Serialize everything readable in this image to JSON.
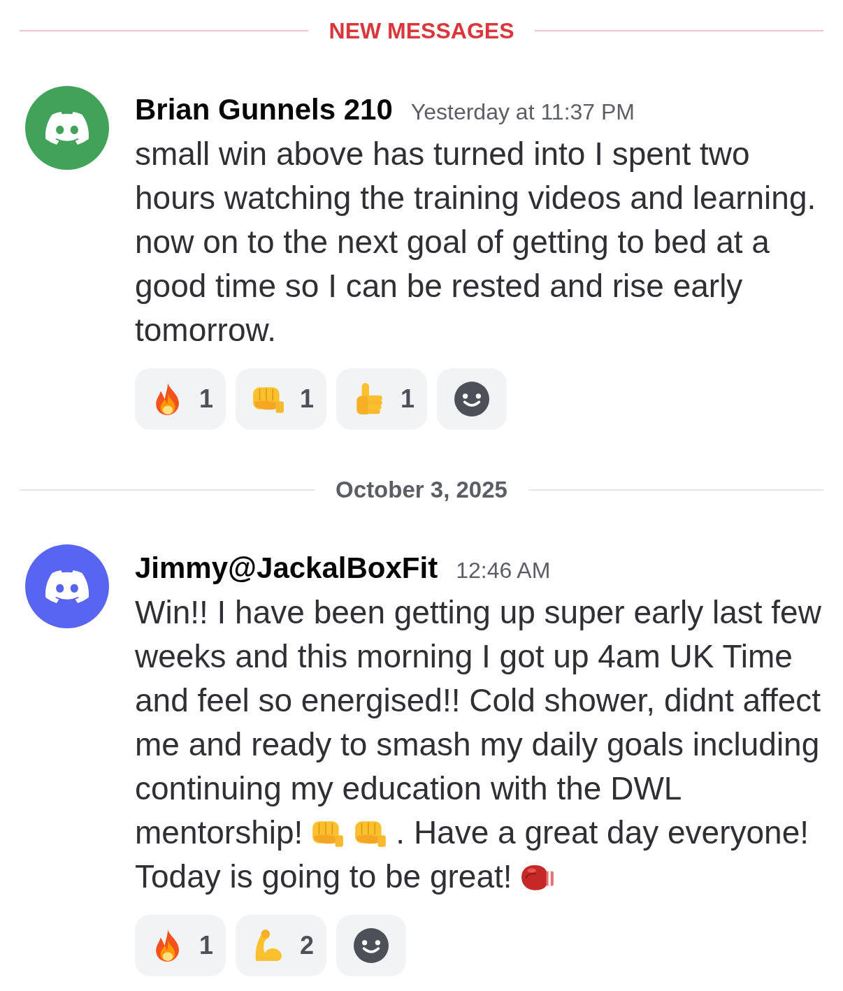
{
  "feed": [
    {
      "kind": "new",
      "label": "NEW MESSAGES"
    },
    {
      "kind": "message",
      "author": "Brian Gunnels 210",
      "timestamp": "Yesterday at 11:37 PM",
      "avatar": {
        "color": "#43a25a"
      },
      "body": [
        {
          "parts": [
            {
              "kind": "text",
              "text": "small win above has turned into I spent two hours watching the training videos and learning. now on to the next goal of getting to bed at a good time so I can be rested and rise early tomorrow."
            }
          ]
        }
      ],
      "reactions": [
        {
          "kind": "fire",
          "count": "1"
        },
        {
          "kind": "fist",
          "count": "1"
        },
        {
          "kind": "thumbsup",
          "count": "1"
        },
        {
          "kind": "add"
        }
      ]
    },
    {
      "kind": "date",
      "label": "October 3, 2025"
    },
    {
      "kind": "message",
      "author": "Jimmy@JackalBoxFit",
      "timestamp": "12:46 AM",
      "avatar": {
        "color": "#5865f2"
      },
      "body": [
        {
          "parts": [
            {
              "kind": "text",
              "text": "Win!! I have been getting up super early last few weeks and this morning I got up 4am UK Time and feel so energised!! Cold shower, didnt affect me and ready to smash my daily goals including continuing my education with the DWL"
            }
          ]
        },
        {
          "parts": [
            {
              "kind": "text",
              "text": "mentorship!"
            },
            {
              "kind": "fist"
            },
            {
              "kind": "fist"
            },
            {
              "kind": "text",
              "text": ". Have a great day everyone!"
            }
          ]
        },
        {
          "parts": [
            {
              "kind": "text",
              "text": "Today is going to be great!"
            },
            {
              "kind": "glove"
            }
          ]
        }
      ],
      "reactions": [
        {
          "kind": "fire",
          "count": "1"
        },
        {
          "kind": "biceps",
          "count": "2"
        },
        {
          "kind": "add"
        }
      ]
    }
  ]
}
